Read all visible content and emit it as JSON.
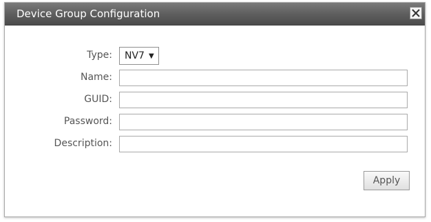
{
  "dialog": {
    "title": "Device Group Configuration",
    "close_label": "×"
  },
  "form": {
    "type": {
      "label": "Type:",
      "value": "NV7",
      "arrow": "▼"
    },
    "name": {
      "label": "Name:",
      "value": ""
    },
    "guid": {
      "label": "GUID:",
      "value": ""
    },
    "password": {
      "label": "Password:",
      "value": ""
    },
    "description": {
      "label": "Description:",
      "value": ""
    }
  },
  "actions": {
    "apply_label": "Apply"
  }
}
